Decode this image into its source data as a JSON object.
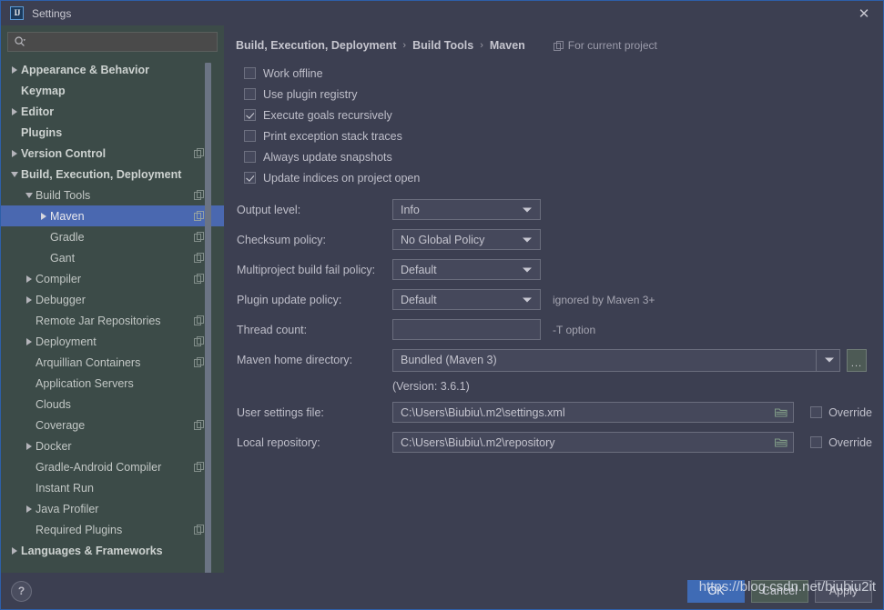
{
  "window": {
    "title": "Settings",
    "logo_text": "IJ",
    "close_label": "✕"
  },
  "search": {
    "value": "",
    "placeholder": "",
    "icon": "search-icon"
  },
  "sidebar": {
    "items": [
      {
        "label": "Appearance & Behavior",
        "indent": 0,
        "arrow": "right",
        "bold": true,
        "copy": false,
        "selected": false
      },
      {
        "label": "Keymap",
        "indent": 0,
        "arrow": "none",
        "bold": true,
        "copy": false,
        "selected": false
      },
      {
        "label": "Editor",
        "indent": 0,
        "arrow": "right",
        "bold": true,
        "copy": false,
        "selected": false
      },
      {
        "label": "Plugins",
        "indent": 0,
        "arrow": "none",
        "bold": true,
        "copy": false,
        "selected": false
      },
      {
        "label": "Version Control",
        "indent": 0,
        "arrow": "right",
        "bold": true,
        "copy": true,
        "selected": false
      },
      {
        "label": "Build, Execution, Deployment",
        "indent": 0,
        "arrow": "down",
        "bold": true,
        "copy": false,
        "selected": false
      },
      {
        "label": "Build Tools",
        "indent": 1,
        "arrow": "down",
        "bold": false,
        "copy": true,
        "selected": false
      },
      {
        "label": "Maven",
        "indent": 2,
        "arrow": "right",
        "bold": false,
        "copy": true,
        "selected": true
      },
      {
        "label": "Gradle",
        "indent": 2,
        "arrow": "none",
        "bold": false,
        "copy": true,
        "selected": false
      },
      {
        "label": "Gant",
        "indent": 2,
        "arrow": "none",
        "bold": false,
        "copy": true,
        "selected": false
      },
      {
        "label": "Compiler",
        "indent": 1,
        "arrow": "right",
        "bold": false,
        "copy": true,
        "selected": false
      },
      {
        "label": "Debugger",
        "indent": 1,
        "arrow": "right",
        "bold": false,
        "copy": false,
        "selected": false
      },
      {
        "label": "Remote Jar Repositories",
        "indent": 1,
        "arrow": "none",
        "bold": false,
        "copy": true,
        "selected": false
      },
      {
        "label": "Deployment",
        "indent": 1,
        "arrow": "right",
        "bold": false,
        "copy": true,
        "selected": false
      },
      {
        "label": "Arquillian Containers",
        "indent": 1,
        "arrow": "none",
        "bold": false,
        "copy": true,
        "selected": false
      },
      {
        "label": "Application Servers",
        "indent": 1,
        "arrow": "none",
        "bold": false,
        "copy": false,
        "selected": false
      },
      {
        "label": "Clouds",
        "indent": 1,
        "arrow": "none",
        "bold": false,
        "copy": false,
        "selected": false
      },
      {
        "label": "Coverage",
        "indent": 1,
        "arrow": "none",
        "bold": false,
        "copy": true,
        "selected": false
      },
      {
        "label": "Docker",
        "indent": 1,
        "arrow": "right",
        "bold": false,
        "copy": false,
        "selected": false
      },
      {
        "label": "Gradle-Android Compiler",
        "indent": 1,
        "arrow": "none",
        "bold": false,
        "copy": true,
        "selected": false
      },
      {
        "label": "Instant Run",
        "indent": 1,
        "arrow": "none",
        "bold": false,
        "copy": false,
        "selected": false
      },
      {
        "label": "Java Profiler",
        "indent": 1,
        "arrow": "right",
        "bold": false,
        "copy": false,
        "selected": false
      },
      {
        "label": "Required Plugins",
        "indent": 1,
        "arrow": "none",
        "bold": false,
        "copy": true,
        "selected": false
      },
      {
        "label": "Languages & Frameworks",
        "indent": 0,
        "arrow": "right",
        "bold": true,
        "copy": false,
        "selected": false
      }
    ]
  },
  "content": {
    "breadcrumb": {
      "parts": [
        "Build, Execution, Deployment",
        "Build Tools",
        "Maven"
      ],
      "separator": "›"
    },
    "for_current_project": "For current project",
    "checkboxes": [
      {
        "label": "Work offline",
        "checked": false
      },
      {
        "label": "Use plugin registry",
        "checked": false
      },
      {
        "label": "Execute goals recursively",
        "checked": true
      },
      {
        "label": "Print exception stack traces",
        "checked": false
      },
      {
        "label": "Always update snapshots",
        "checked": false
      },
      {
        "label": "Update indices on project open",
        "checked": true
      }
    ],
    "fields": {
      "output_level": {
        "label": "Output level:",
        "value": "Info",
        "hint": ""
      },
      "checksum_policy": {
        "label": "Checksum policy:",
        "value": "No Global Policy",
        "hint": ""
      },
      "multiproject_policy": {
        "label": "Multiproject build fail policy:",
        "value": "Default",
        "hint": ""
      },
      "plugin_update_policy": {
        "label": "Plugin update policy:",
        "value": "Default",
        "hint": "ignored by Maven 3+"
      },
      "thread_count": {
        "label": "Thread count:",
        "value": "",
        "hint": "-T option"
      }
    },
    "maven_home": {
      "label": "Maven home directory:",
      "value": "Bundled (Maven 3)",
      "browse_label": "...",
      "version": "(Version: 3.6.1)"
    },
    "user_settings": {
      "label": "User settings file:",
      "value": "C:\\Users\\Biubiu\\.m2\\settings.xml",
      "override_label": "Override",
      "override_checked": false
    },
    "local_repository": {
      "label": "Local repository:",
      "value": "C:\\Users\\Biubiu\\.m2\\repository",
      "override_label": "Override",
      "override_checked": false
    }
  },
  "footer": {
    "help_label": "?",
    "ok_label": "OK",
    "cancel_label": "Cancel",
    "apply_label": "Apply"
  },
  "watermark": {
    "url": "https://blog.csdn.net/biubiu2it",
    "sub": "csdn"
  },
  "colors": {
    "window_bg": "#3c3f51",
    "sidebar_bg": "#3c4b48",
    "selection": "#4a68b0",
    "accent_border": "#2d5fa8",
    "primary_button": "#3f6bb5"
  }
}
